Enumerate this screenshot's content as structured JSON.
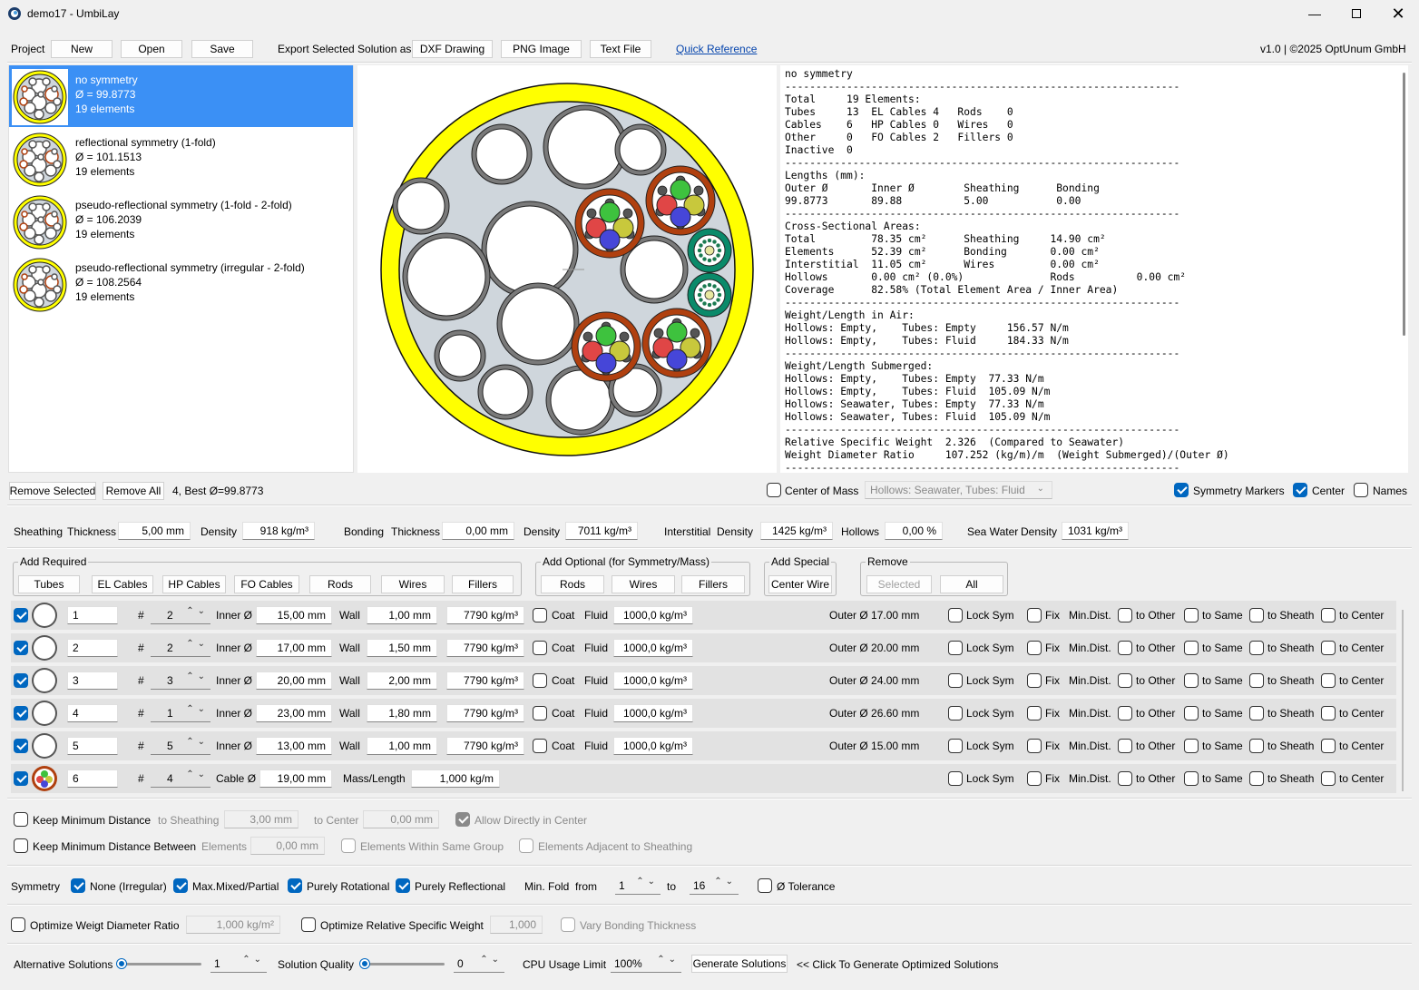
{
  "window": {
    "title": "demo17 - UmbiLay"
  },
  "menu": {
    "project": "Project",
    "new": "New",
    "open": "Open",
    "save": "Save",
    "export_label": "Export Selected Solution as",
    "dxf": "DXF Drawing",
    "png": "PNG Image",
    "text": "Text File",
    "quick_ref": "Quick Reference",
    "version": "v1.0 | ©2025 OptUnum GmbH"
  },
  "solutions": [
    {
      "name": "no symmetry",
      "diameter": "Ø = 99.8773",
      "elements": "19 elements"
    },
    {
      "name": "reflectional symmetry (1-fold)",
      "diameter": "Ø = 101.1513",
      "elements": "19 elements"
    },
    {
      "name": "pseudo-reflectional symmetry (1-fold - 2-fold)",
      "diameter": "Ø = 106.2039",
      "elements": "19 elements"
    },
    {
      "name": "pseudo-reflectional symmetry (irregular - 2-fold)",
      "diameter": "Ø = 108.2564",
      "elements": "19 elements"
    }
  ],
  "report": [
    "no symmetry",
    "----------------------------------------------------------------",
    "Total     19 Elements:",
    "Tubes     13  EL Cables 4   Rods    0",
    "Cables    6   HP Cables 0   Wires   0",
    "Other     0   FO Cables 2   Fillers 0",
    "Inactive  0",
    "----------------------------------------------------------------",
    "Lengths (mm):",
    "Outer Ø       Inner Ø        Sheathing      Bonding",
    "99.8773       89.88          5.00           0.00",
    "----------------------------------------------------------------",
    "Cross-Sectional Areas:",
    "Total         78.35 cm²      Sheathing     14.90 cm²",
    "Elements      52.39 cm²      Bonding       0.00 cm²",
    "Interstitial  11.05 cm²      Wires         0.00 cm²",
    "Hollows       0.00 cm² (0.0%)              Rods          0.00 cm²",
    "Coverage      82.58% (Total Element Area / Inner Area)",
    "----------------------------------------------------------------",
    "Weight/Length in Air:",
    "Hollows: Empty,    Tubes: Empty     156.57 N/m",
    "Hollows: Empty,    Tubes: Fluid     184.33 N/m",
    "----------------------------------------------------------------",
    "Weight/Length Submerged:",
    "Hollows: Empty,    Tubes: Empty  77.33 N/m",
    "Hollows: Empty,    Tubes: Fluid  105.09 N/m",
    "Hollows: Seawater, Tubes: Empty  77.33 N/m",
    "Hollows: Seawater, Tubes: Fluid  105.09 N/m",
    "----------------------------------------------------------------",
    "Relative Specific Weight  2.326  (Compared to Seawater)",
    "Weight Diameter Ratio     107.252 (kg/m)/m  (Weight Submerged)/(Outer Ø)",
    "----------------------------------------------------------------"
  ],
  "list_bar": {
    "remove_selected": "Remove Selected",
    "remove_all": "Remove All",
    "status": "4, Best Ø=99.8773",
    "center_of_mass": "Center of Mass",
    "hollows_select": "Hollows: Seawater, Tubes: Fluid",
    "symmetry_markers": "Symmetry Markers",
    "center": "Center",
    "names": "Names"
  },
  "materials": {
    "sheathing": "Sheathing",
    "thickness": "Thickness",
    "sheathing_thickness": "5,00 mm",
    "density": "Density",
    "sheathing_density": "918 kg/m³",
    "bonding": "Bonding",
    "bonding_thickness": "0,00 mm",
    "bonding_density": "7011 kg/m³",
    "interstitial": "Interstitial",
    "interstitial_density": "1425 kg/m³",
    "hollows": "Hollows",
    "hollows_value": "0,00 %",
    "sea_water": "Sea Water",
    "sea_water_density": "1031 kg/m³"
  },
  "add_required": {
    "title": "Add Required",
    "items": [
      "Tubes",
      "EL Cables",
      "HP Cables",
      "FO Cables",
      "Rods",
      "Wires",
      "Fillers"
    ]
  },
  "add_optional": {
    "title": "Add Optional (for Symmetry/Mass)",
    "items": [
      "Rods",
      "Wires",
      "Fillers"
    ]
  },
  "add_special": {
    "title": "Add Special",
    "items": [
      "Center Wire"
    ]
  },
  "remove_group": {
    "title": "Remove",
    "selected": "Selected",
    "all": "All"
  },
  "elements": [
    {
      "id": "1",
      "count": "2",
      "inner": "15,00 mm",
      "wall": "1,00 mm",
      "density": "7790 kg/m³",
      "fluid": "1000,0 kg/m³",
      "outer": "Outer Ø 17.00 mm"
    },
    {
      "id": "2",
      "count": "2",
      "inner": "17,00 mm",
      "wall": "1,50 mm",
      "density": "7790 kg/m³",
      "fluid": "1000,0 kg/m³",
      "outer": "Outer Ø 20.00 mm"
    },
    {
      "id": "3",
      "count": "3",
      "inner": "20,00 mm",
      "wall": "2,00 mm",
      "density": "7790 kg/m³",
      "fluid": "1000,0 kg/m³",
      "outer": "Outer Ø 24.00 mm"
    },
    {
      "id": "4",
      "count": "1",
      "inner": "23,00 mm",
      "wall": "1,80 mm",
      "density": "7790 kg/m³",
      "fluid": "1000,0 kg/m³",
      "outer": "Outer Ø 26.60 mm"
    },
    {
      "id": "5",
      "count": "5",
      "inner": "13,00 mm",
      "wall": "1,00 mm",
      "density": "7790 kg/m³",
      "fluid": "1000,0 kg/m³",
      "outer": "Outer Ø 15.00 mm"
    }
  ],
  "cable_element": {
    "id": "6",
    "count": "4",
    "cable_d_label": "Cable Ø",
    "cable_d": "19,00 mm",
    "mass_label": "Mass/Length",
    "mass": "1,000 kg/m"
  },
  "row_labels": {
    "hash": "#",
    "inner": "Inner Ø",
    "wall": "Wall",
    "coat": "Coat",
    "fluid": "Fluid",
    "lock_sym": "Lock Sym",
    "fix": "Fix",
    "min_dist": "Min.Dist.",
    "to_other": "to Other",
    "to_same": "to Same",
    "to_sheath": "to Sheath",
    "to_center": "to Center"
  },
  "constraints": {
    "keep_min": "Keep Minimum Distance",
    "to_sheathing": "to Sheathing",
    "sheathing_val": "3,00 mm",
    "to_center": "to Center",
    "center_val": "0,00 mm",
    "allow_center": "Allow Directly in Center",
    "keep_between": "Keep Minimum Distance Between",
    "elements": "Elements",
    "elements_val": "0,00 mm",
    "within_group": "Elements Within Same Group",
    "adjacent": "Elements Adjacent to Sheathing"
  },
  "symmetry": {
    "label": "Symmetry",
    "none": "None (Irregular)",
    "mixed": "Max.Mixed/Partial",
    "rotational": "Purely Rotational",
    "reflectional": "Purely Reflectional",
    "min_fold": "Min. Fold",
    "from": "from",
    "from_val": "1",
    "to": "to",
    "to_val": "16",
    "tolerance": "Ø Tolerance"
  },
  "optimize": {
    "wdr": "Optimize Weigt Diameter Ratio",
    "wdr_val": "1,000 kg/m²",
    "rsw": "Optimize Relative Specific Weight",
    "rsw_val": "1,000",
    "vary": "Vary Bonding Thickness"
  },
  "bottom": {
    "alt": "Alternative Solutions",
    "alt_val": "1",
    "quality": "Solution Quality",
    "quality_val": "0",
    "cpu": "CPU Usage Limit",
    "cpu_val": "100%",
    "generate": "Generate Solutions",
    "hint": "<< Click To Generate Optimized Solutions"
  },
  "colors": {
    "accent": "#0067c0",
    "selection": "#3b90f5",
    "sheath": "#ffff00",
    "cable_jacket": "#b0400f",
    "fo_cable": "#0a8a6a"
  }
}
